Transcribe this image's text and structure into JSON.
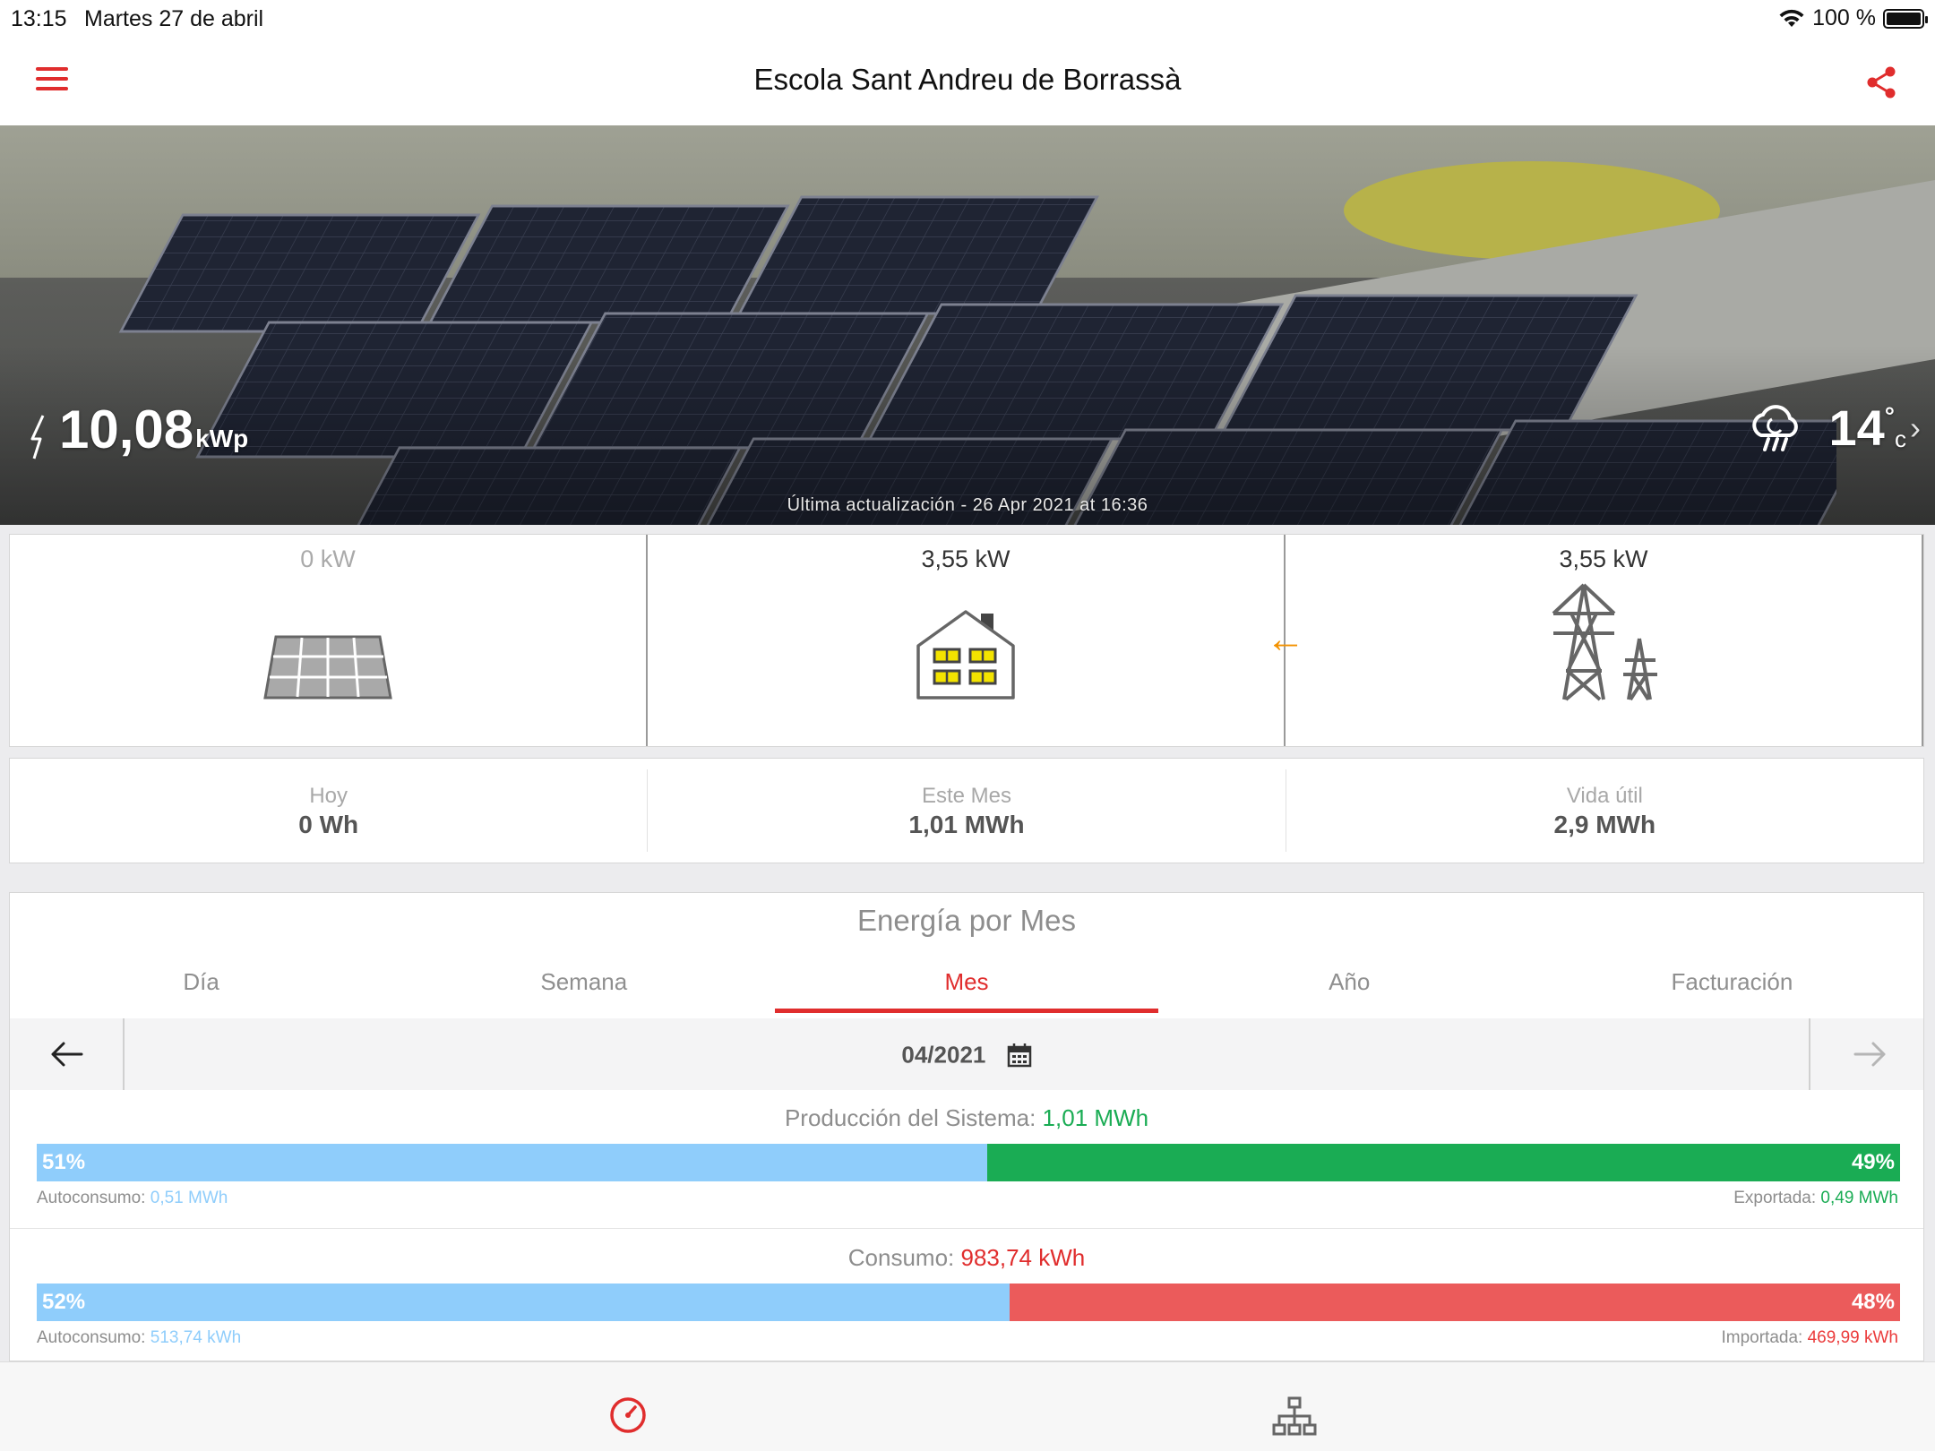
{
  "status_bar": {
    "time": "13:15",
    "date": "Martes 27 de abril",
    "battery": "100 %"
  },
  "nav": {
    "title": "Escola Sant Andreu de Borrassà"
  },
  "hero": {
    "peak_power": "10,08",
    "peak_unit": "kWp",
    "last_update": "Última actualización - 26 Apr 2021 at 16:36",
    "temperature": "14",
    "temp_deg": "°",
    "temp_unit": "c",
    "chevron": "›"
  },
  "flow": {
    "solar": {
      "value": "0 kW",
      "icon": "solar-panel-icon"
    },
    "home": {
      "value": "3,55 kW",
      "icon": "house-icon"
    },
    "grid": {
      "value": "3,55 kW",
      "icon": "power-tower-icon"
    },
    "arrow": "←",
    "colors": {
      "arrow": "#f39200"
    }
  },
  "totals": [
    {
      "label": "Hoy",
      "value": "0 Wh"
    },
    {
      "label": "Este Mes",
      "value": "1,01 MWh"
    },
    {
      "label": "Vida útil",
      "value": "2,9 MWh"
    }
  ],
  "energy": {
    "title": "Energía por Mes",
    "tabs": [
      "Día",
      "Semana",
      "Mes",
      "Año",
      "Facturación"
    ],
    "active_tab": "Mes",
    "period": "04/2021",
    "production": {
      "label": "Producción del Sistema:",
      "value": "1,01 MWh",
      "left_pct": "51%",
      "right_pct": "49%",
      "left_fraction": 0.51,
      "left_label": "Autoconsumo:",
      "left_value": "0,51 MWh",
      "right_label": "Exportada:",
      "right_value": "0,49 MWh"
    },
    "consumption": {
      "label": "Consumo:",
      "value": "983,74 kWh",
      "left_pct": "52%",
      "right_pct": "48%",
      "left_fraction": 0.522,
      "left_label": "Autoconsumo:",
      "left_value": "513,74 kWh",
      "right_label": "Importada:",
      "right_value": "469,99 kWh"
    },
    "colors": {
      "autoconsumo": "#8fcdfb",
      "exported": "#1aac54",
      "imported": "#eb5b5b",
      "accent": "#e02d2d"
    }
  },
  "tabbar": {
    "items": [
      "gauge-icon",
      "network-icon"
    ]
  }
}
